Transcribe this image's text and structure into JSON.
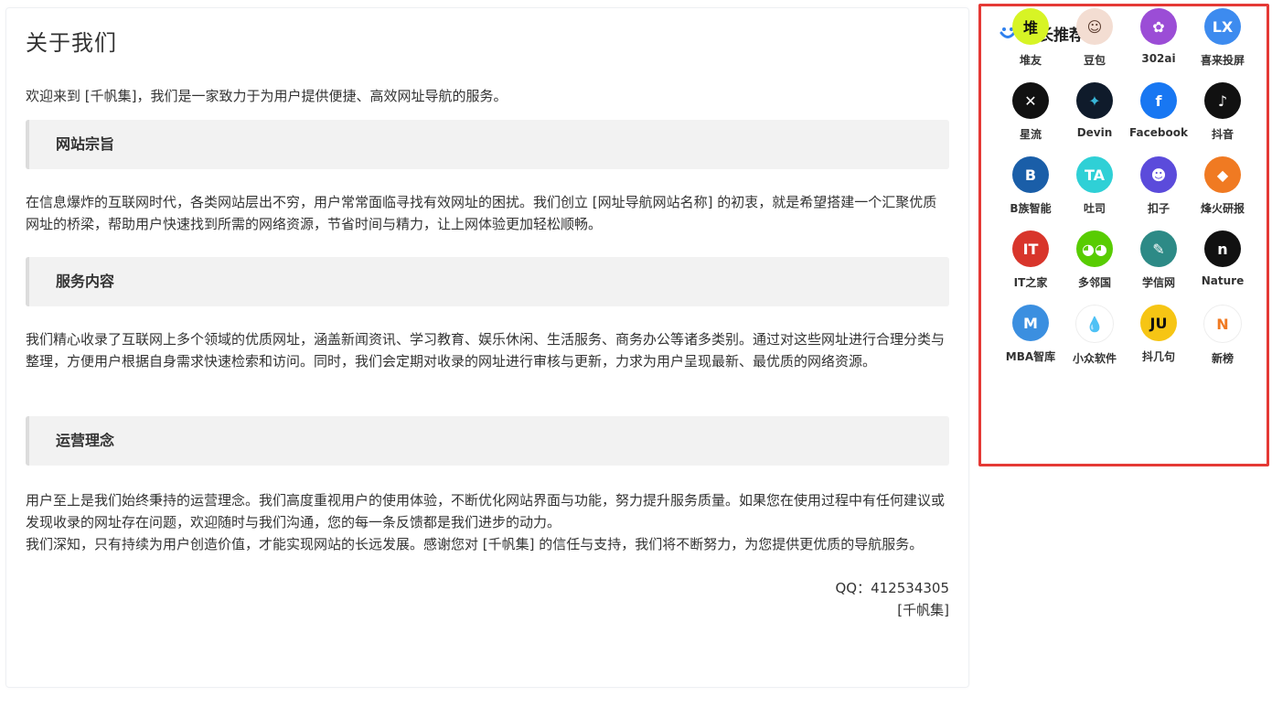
{
  "about": {
    "title": "关于我们",
    "intro": "欢迎来到 [千帆集]，我们是一家致力于为用户提供便捷、高效网址导航的服务。",
    "sections": [
      {
        "heading": "网站宗旨",
        "text": "在信息爆炸的互联网时代，各类网站层出不穷，用户常常面临寻找有效网址的困扰。我们创立 [网址导航网站名称] 的初衷，就是希望搭建一个汇聚优质网址的桥梁，帮助用户快速找到所需的网络资源，节省时间与精力，让上网体验更加轻松顺畅。"
      },
      {
        "heading": "服务内容",
        "text": "我们精心收录了互联网上多个领域的优质网址，涵盖新闻资讯、学习教育、娱乐休闲、生活服务、商务办公等诸多类别。通过对这些网址进行合理分类与整理，方便用户根据自身需求快速检索和访问。同时，我们会定期对收录的网址进行审核与更新，力求为用户呈现最新、最优质的网络资源。"
      },
      {
        "heading": "运营理念",
        "text": "用户至上是我们始终秉持的运营理念。我们高度重视用户的使用体验，不断优化网站界面与功能，努力提升服务质量。如果您在使用过程中有任何建议或发现收录的网址存在问题，欢迎随时与我们沟通，您的每一条反馈都是我们进步的动力。"
      }
    ],
    "closing": "我们深知，只有持续为用户创造价值，才能实现网站的长远发展。感谢您对 [千帆集] 的信任与支持，我们将不断努力，为您提供更优质的导航服务。",
    "qq": "QQ：412534305",
    "signature": "[千帆集]"
  },
  "sidebar": {
    "title": "站长推荐",
    "title_icon": "smile-icon",
    "accent": "#e53935",
    "items": [
      {
        "label": "堆友",
        "logo_text": "堆",
        "bg": "#d7f425",
        "fg": "#111111",
        "icon": "duiyou-logo-icon"
      },
      {
        "label": "豆包",
        "logo_text": "☺",
        "bg": "#f3ddd2",
        "fg": "#5a3b2e",
        "icon": "doubao-avatar-icon"
      },
      {
        "label": "302ai",
        "logo_text": "✿",
        "bg": "#9b4dd6",
        "fg": "#ffffff",
        "icon": "302ai-logo-icon"
      },
      {
        "label": "喜来投屏",
        "logo_text": "LX",
        "bg": "#3d8bef",
        "fg": "#ffffff",
        "icon": "xilai-logo-icon"
      },
      {
        "label": "星流",
        "logo_text": "✕",
        "bg": "#111111",
        "fg": "#ffffff",
        "icon": "xingliu-logo-icon"
      },
      {
        "label": "Devin",
        "logo_text": "✦",
        "bg": "#0f1b2b",
        "fg": "#38b6d8",
        "icon": "devin-logo-icon"
      },
      {
        "label": "Facebook",
        "logo_text": "f",
        "bg": "#1877f2",
        "fg": "#ffffff",
        "icon": "facebook-logo-icon"
      },
      {
        "label": "抖音",
        "logo_text": "♪",
        "bg": "#111111",
        "fg": "#ffffff",
        "icon": "douyin-logo-icon"
      },
      {
        "label": "B族智能",
        "logo_text": "B",
        "bg": "#1a5ea8",
        "fg": "#ffffff",
        "icon": "bzu-logo-icon"
      },
      {
        "label": "吐司",
        "logo_text": "TA",
        "bg": "#2fd0d6",
        "fg": "#ffffff",
        "icon": "tusi-logo-icon"
      },
      {
        "label": "扣子",
        "logo_text": "☻",
        "bg": "#5b4bdb",
        "fg": "#ffffff",
        "icon": "kouzi-logo-icon"
      },
      {
        "label": "烽火研报",
        "logo_text": "◆",
        "bg": "#f07a22",
        "fg": "#ffffff",
        "icon": "fenghuo-logo-icon"
      },
      {
        "label": "IT之家",
        "logo_text": "IT",
        "bg": "#d8352b",
        "fg": "#ffffff",
        "icon": "ithome-logo-icon"
      },
      {
        "label": "多邻国",
        "logo_text": "◕◕",
        "bg": "#58cc02",
        "fg": "#ffffff",
        "icon": "duolingo-logo-icon"
      },
      {
        "label": "学信网",
        "logo_text": "✎",
        "bg": "#2d8a86",
        "fg": "#ffffff",
        "icon": "xuexin-logo-icon"
      },
      {
        "label": "Nature",
        "logo_text": "n",
        "bg": "#111111",
        "fg": "#ffffff",
        "icon": "nature-logo-icon"
      },
      {
        "label": "MBA智库",
        "logo_text": "M",
        "bg": "#3b8fe0",
        "fg": "#ffffff",
        "icon": "mba-logo-icon"
      },
      {
        "label": "小众软件",
        "logo_text": "💧",
        "bg": "#ffffff",
        "fg": "#1e88e5",
        "icon": "appinn-logo-icon"
      },
      {
        "label": "抖几句",
        "logo_text": "JU",
        "bg": "#f6c514",
        "fg": "#111111",
        "icon": "doujiju-logo-icon"
      },
      {
        "label": "新榜",
        "logo_text": "N",
        "bg": "#ffffff",
        "fg": "#f07a22",
        "icon": "xinbang-logo-icon"
      }
    ]
  }
}
